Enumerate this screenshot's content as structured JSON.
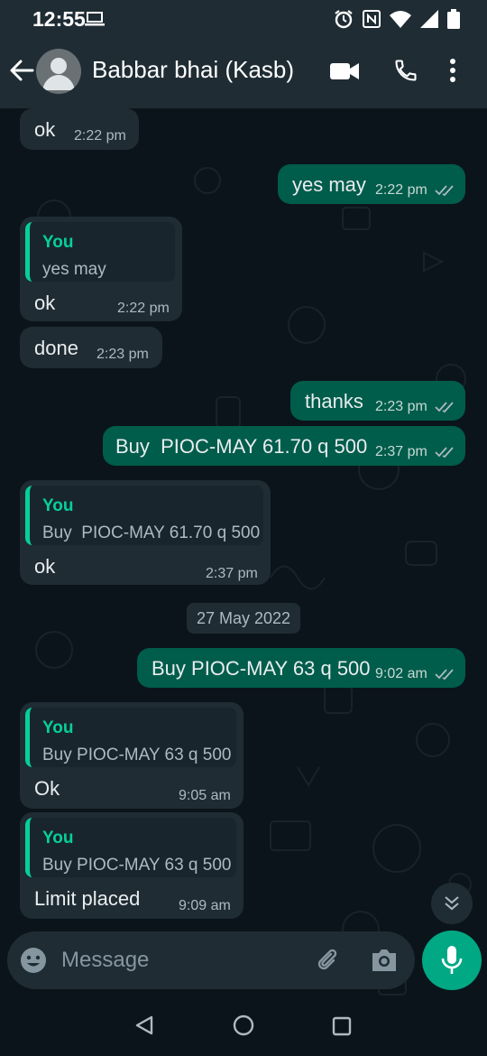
{
  "status_bar": {
    "time": "12:55"
  },
  "header": {
    "contact_name": "Babbar bhai (Kasb)"
  },
  "messages": [
    {
      "dir": "in",
      "text": "ok",
      "time": "2:22 pm"
    },
    {
      "dir": "out",
      "text": "yes may",
      "time": "2:22 pm"
    },
    {
      "dir": "in",
      "quote_author": "You",
      "quote_text": "yes may",
      "text": "ok",
      "time": "2:22 pm"
    },
    {
      "dir": "in",
      "text": "done",
      "time": "2:23 pm"
    },
    {
      "dir": "out",
      "text": "thanks",
      "time": "2:23 pm"
    },
    {
      "dir": "out",
      "text": "Buy  PIOC-MAY 61.70 q 500",
      "time": "2:37 pm"
    },
    {
      "dir": "in",
      "quote_author": "You",
      "quote_text": "Buy  PIOC-MAY 61.70 q 500",
      "text": "ok",
      "time": "2:37 pm"
    },
    {
      "dir": "out",
      "text": "Buy PIOC-MAY 63 q 500",
      "time": "9:02 am"
    },
    {
      "dir": "in",
      "quote_author": "You",
      "quote_text": "Buy PIOC-MAY 63 q 500",
      "text": "Ok",
      "time": "9:05 am"
    },
    {
      "dir": "in",
      "quote_author": "You",
      "quote_text": "Buy PIOC-MAY 63 q 500",
      "text": "Limit placed",
      "time": "9:09 am"
    }
  ],
  "date_divider": "27 May 2022",
  "composer": {
    "placeholder": "Message"
  },
  "colors": {
    "background": "#0b141a",
    "incoming_bubble": "#1f2c34",
    "outgoing_bubble": "#005c4b",
    "accent": "#00a884",
    "quote_author": "#06cf9c",
    "read_ticks": "#aebac1"
  },
  "icons": [
    "back-arrow-icon",
    "avatar-icon",
    "video-call-icon",
    "phone-icon",
    "more-options-icon",
    "emoji-icon",
    "attach-icon",
    "camera-icon",
    "mic-icon",
    "scroll-down-icon"
  ]
}
